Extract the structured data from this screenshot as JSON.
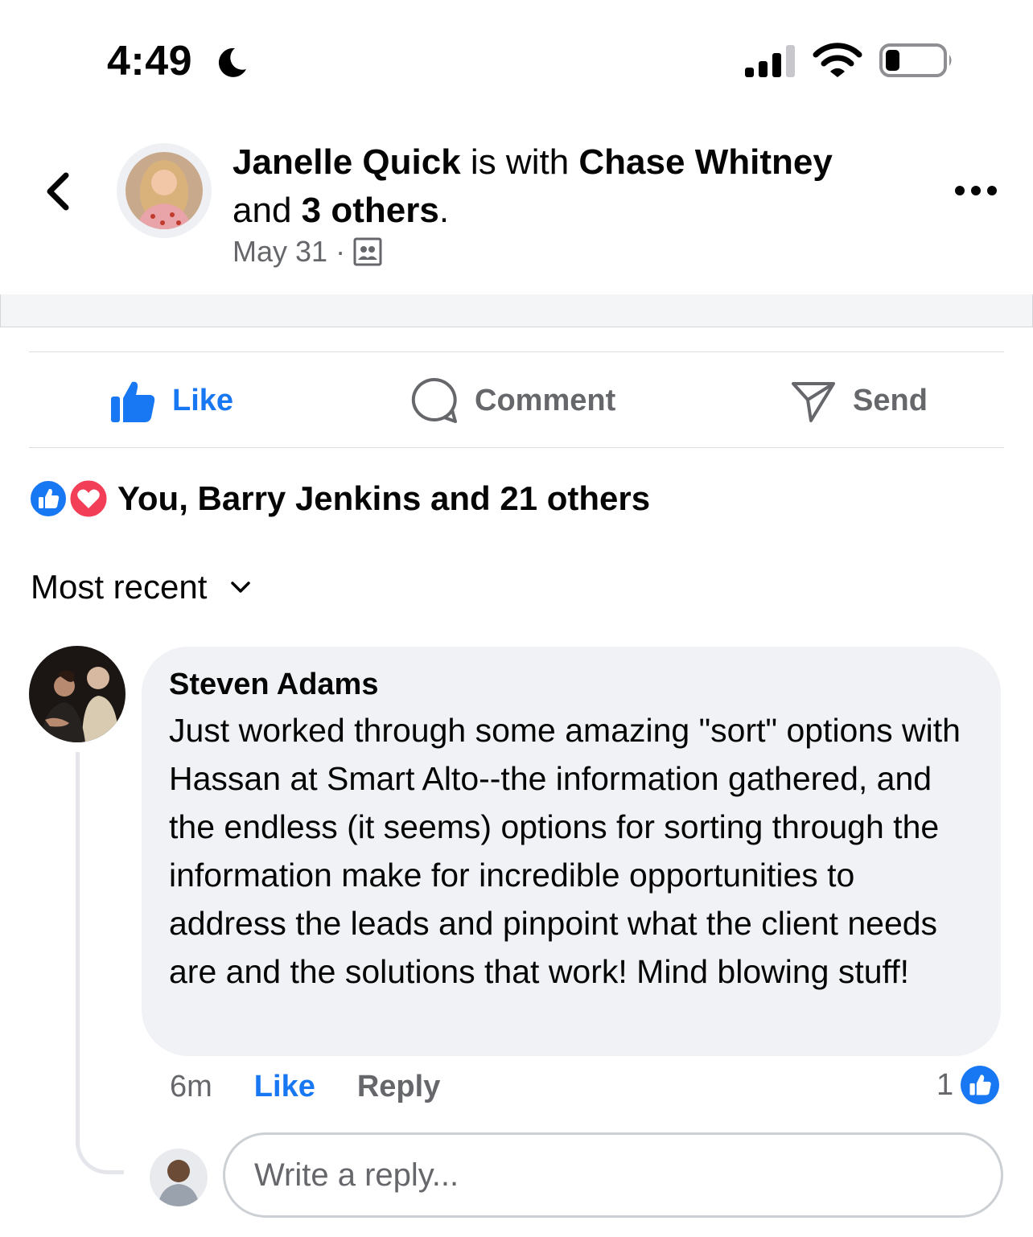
{
  "status_bar": {
    "time": "4:49",
    "battery_level": 0.25
  },
  "header": {
    "author": "Janelle Quick",
    "connector": " is with ",
    "tagged_first": "Chase Whitney",
    "and_text": "and ",
    "others": "3 others",
    "period": ".",
    "date": "May 31",
    "separator": "·",
    "audience_icon": "friends-icon"
  },
  "actions": {
    "like": "Like",
    "comment": "Comment",
    "send": "Send"
  },
  "reactions": {
    "summary": "You, Barry Jenkins and 21 others"
  },
  "sort": {
    "label": "Most recent"
  },
  "comment": {
    "author": "Steven Adams",
    "text": "Just worked through some amazing \"sort\" options with Hassan at Smart Alto--the information gathered, and the endless (it seems) options for sorting through the information make for incredible opportunities to address the leads and pinpoint what the client needs are and the solutions that work!  Mind blowing stuff!",
    "time": "6m",
    "like": "Like",
    "reply": "Reply",
    "reaction_count": "1"
  },
  "reply_input": {
    "placeholder": "Write a reply..."
  },
  "colors": {
    "accent": "#1877f2",
    "love": "#f33e58",
    "secondary_text": "#65676b",
    "bubble": "#f0f2f5"
  }
}
